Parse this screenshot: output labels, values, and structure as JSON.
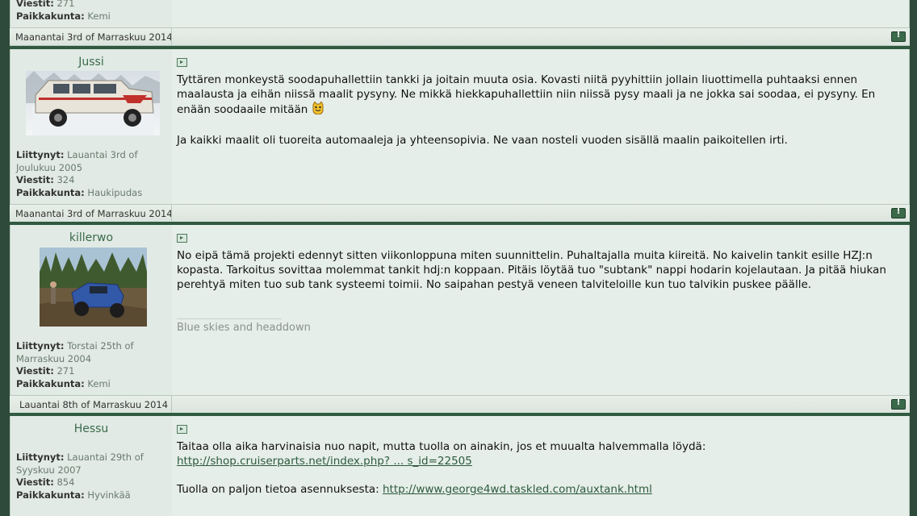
{
  "posts": [
    {
      "meta": {
        "posts_label": "Viestit:",
        "posts": "271",
        "location_label": "Paikkakunta:",
        "location": "Kemi"
      },
      "date": "Maanantai 3rd of Marraskuu 2014"
    },
    {
      "username": "Jussi",
      "meta": {
        "joined_label": "Liittynyt:",
        "joined": "Lauantai 3rd of Joulukuu 2005",
        "posts_label": "Viestit:",
        "posts": "324",
        "location_label": "Paikkakunta:",
        "location": "Haukipudas"
      },
      "paragraphs": [
        "Tyttären monkeystä soodapuhallettiin tankki ja joitain muuta osia. Kovasti niitä pyyhittiin jollain liuottimella puhtaaksi ennen maalausta ja eihän niissä maalit pysyny. Ne mikkä hiekkapuhallettiin niin niissä pysy maali ja ne jokka sai soodaa, ei pysyny. En enään soodaaile mitään",
        "Ja kaikki maalit oli tuoreita automaaleja ja yhteensopivia. Ne vaan nosteli vuoden sisällä maalin paikoitellen irti."
      ],
      "date": "Maanantai 3rd of Marraskuu 2014"
    },
    {
      "username": "killerwo",
      "meta": {
        "joined_label": "Liittynyt:",
        "joined": "Torstai 25th of Marraskuu 2004",
        "posts_label": "Viestit:",
        "posts": "271",
        "location_label": "Paikkakunta:",
        "location": "Kemi"
      },
      "paragraphs": [
        "No eipä tämä projekti edennyt sitten viikonloppuna miten suunnittelin. Puhaltajalla muita kiireitä. No kaivelin tankit esille HZJ:n kopasta. Tarkoitus sovittaa molemmat tankit hdj:n koppaan. Pitäis löytää tuo \"subtank\" nappi hodarin kojelautaan. Ja pitää hiukan perehtyä miten tuo sub tank systeemi toimii. No saipahan pestyä veneen talviteloille kun tuo talvikin puskee päälle."
      ],
      "signature": "Blue skies and headdown",
      "date": "Lauantai 8th of Marraskuu 2014"
    },
    {
      "username": "Hessu",
      "meta": {
        "joined_label": "Liittynyt:",
        "joined": "Lauantai 29th of Syyskuu 2007",
        "posts_label": "Viestit:",
        "posts": "854",
        "location_label": "Paikkakunta:",
        "location": "Hyvinkää"
      },
      "line1": "Taitaa olla aika harvinaisia nuo napit, mutta tuolla on ainakin, jos et muualta halvemmalla löydä:",
      "link1": "http://shop.cruiserparts.net/index.php? ... s_id=22505",
      "line2_prefix": "Tuolla on paljon tietoa asennuksesta:",
      "link2": "http://www.george4wd.taskled.com/auxtank.html"
    }
  ]
}
